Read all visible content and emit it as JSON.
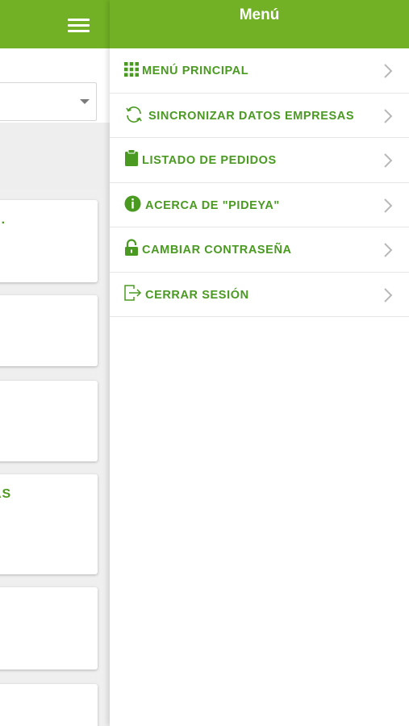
{
  "colors": {
    "brand_green": "#72b125",
    "menu_text_green": "#4a9a22",
    "chevron_grey": "#b8b8b8"
  },
  "background_app": {
    "cards": [
      {
        "text": "S."
      },
      {
        "text": ""
      },
      {
        "text": ""
      },
      {
        "text": "AS"
      },
      {
        "text": "."
      },
      {
        "text": ""
      }
    ]
  },
  "drawer": {
    "title": "Menú",
    "items": [
      {
        "label": "MENÚ PRINCIPAL",
        "icon": "grid-icon"
      },
      {
        "label": "SINCRONIZAR DATOS EMPRESAS",
        "icon": "sync-icon"
      },
      {
        "label": "LISTADO DE PEDIDOS",
        "icon": "clipboard-icon"
      },
      {
        "label": "ACERCA DE \"PIDEYA\"",
        "icon": "info-icon"
      },
      {
        "label": "CAMBIAR CONTRASEÑA",
        "icon": "lock-icon"
      },
      {
        "label": "CERRAR SESIÓN",
        "icon": "logout-icon"
      }
    ]
  }
}
